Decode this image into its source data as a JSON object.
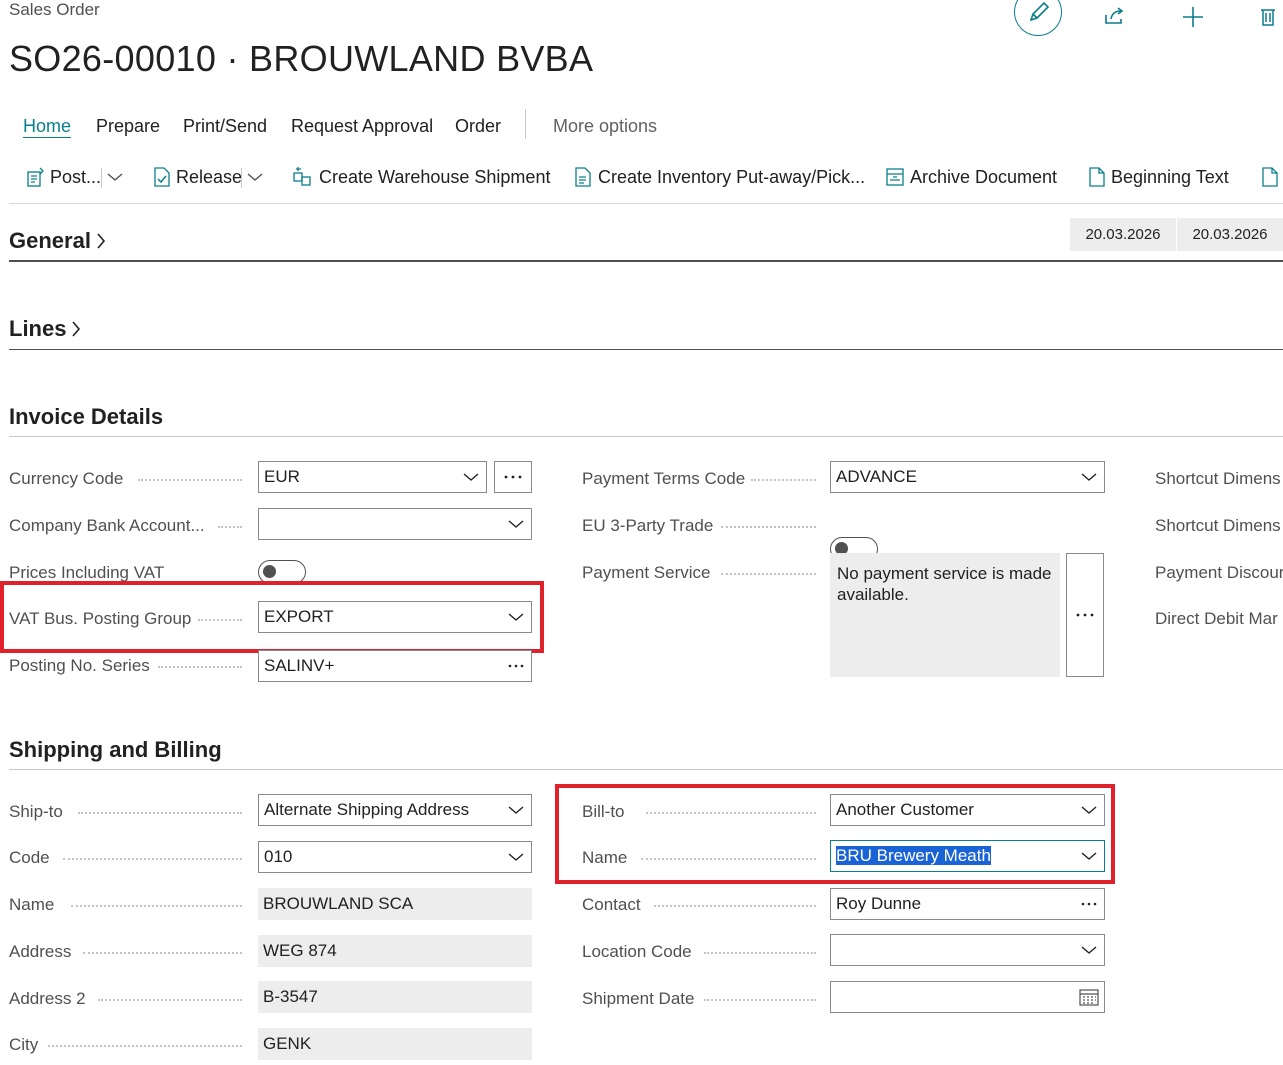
{
  "header": {
    "caption": "Sales Order",
    "title": "SO26-00010 · BROUWLAND BVBA"
  },
  "tabs": [
    {
      "label": "Home"
    },
    {
      "label": "Prepare"
    },
    {
      "label": "Print/Send"
    },
    {
      "label": "Request Approval"
    },
    {
      "label": "Order"
    },
    {
      "label": "More options"
    }
  ],
  "toolbar": {
    "post": "Post...",
    "release": "Release",
    "create_warehouse_shipment": "Create Warehouse Shipment",
    "create_inventory": "Create Inventory Put-away/Pick...",
    "archive_document": "Archive Document",
    "beginning_text": "Beginning Text"
  },
  "sections": {
    "general": "General",
    "lines": "Lines",
    "invoice_details": "Invoice Details",
    "shipping_billing": "Shipping and Billing"
  },
  "general_dates": [
    "20.03.2026",
    "20.03.2026"
  ],
  "invoice": {
    "currency_code": {
      "label": "Currency Code",
      "value": "EUR"
    },
    "company_bank_account": {
      "label": "Company Bank Account...",
      "value": ""
    },
    "prices_including_vat": {
      "label": "Prices Including VAT",
      "value": false
    },
    "vat_bus_posting_group": {
      "label": "VAT Bus. Posting Group",
      "value": "EXPORT"
    },
    "posting_no_series": {
      "label": "Posting No. Series",
      "value": "SALINV+"
    },
    "payment_terms_code": {
      "label": "Payment Terms Code",
      "value": "ADVANCE"
    },
    "eu_3_party_trade": {
      "label": "EU 3-Party Trade",
      "value": false
    },
    "payment_service": {
      "label": "Payment Service",
      "value": "No payment service is made available."
    },
    "shortcut_dim_1": {
      "label": "Shortcut Dimens"
    },
    "shortcut_dim_2": {
      "label": "Shortcut Dimens"
    },
    "payment_discount": {
      "label": "Payment Discour"
    },
    "direct_debit": {
      "label": "Direct Debit Mar"
    }
  },
  "shipping": {
    "ship_to": {
      "label": "Ship-to",
      "value": "Alternate Shipping Address"
    },
    "code": {
      "label": "Code",
      "value": "010"
    },
    "name": {
      "label": "Name",
      "value": "BROUWLAND SCA"
    },
    "address": {
      "label": "Address",
      "value": "WEG 874"
    },
    "address2": {
      "label": "Address 2",
      "value": "B-3547"
    },
    "city": {
      "label": "City",
      "value": "GENK"
    },
    "bill_to": {
      "label": "Bill-to",
      "value": "Another Customer"
    },
    "bill_name": {
      "label": "Name",
      "value": "BRU Brewery Meath"
    },
    "contact": {
      "label": "Contact",
      "value": "Roy Dunne"
    },
    "location_code": {
      "label": "Location Code",
      "value": ""
    },
    "shipment_date": {
      "label": "Shipment Date",
      "value": ""
    }
  },
  "colors": {
    "accent": "#0a7f8c",
    "highlight_box": "#e0202a",
    "selection": "#1a63d6"
  }
}
